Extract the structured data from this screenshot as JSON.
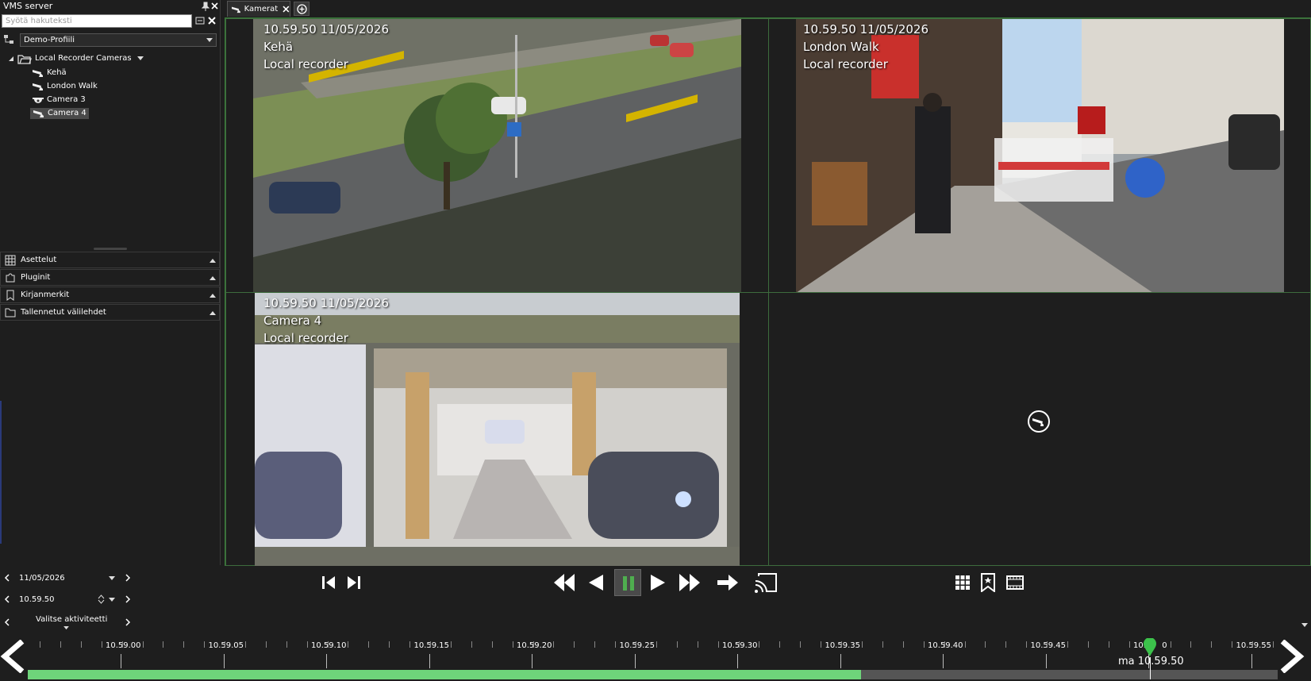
{
  "left_panel": {
    "title": "VMS server",
    "search_placeholder": "Syötä hakuteksti",
    "profile": "Demo-Profiili",
    "tree": {
      "root_label": "Local Recorder Cameras",
      "items": [
        {
          "label": "Kehä",
          "icon": "camera-icon"
        },
        {
          "label": "London Walk",
          "icon": "camera-icon"
        },
        {
          "label": "Camera 3",
          "icon": "dome-camera-icon"
        },
        {
          "label": "Camera 4",
          "icon": "camera-icon",
          "selected": true
        }
      ]
    },
    "sections": [
      {
        "label": "Asettelut",
        "icon": "grid-icon"
      },
      {
        "label": "Pluginit",
        "icon": "puzzle-icon"
      },
      {
        "label": "Kirjanmerkit",
        "icon": "bookmark-icon"
      },
      {
        "label": "Tallennetut välilehdet",
        "icon": "folder-icon"
      }
    ]
  },
  "tabs": {
    "active_label": "Kamerat"
  },
  "cameras": [
    {
      "timestamp": "10.59.50  11/05/2026",
      "name": "Kehä",
      "source": "Local recorder"
    },
    {
      "timestamp": "10.59.50  11/05/2026",
      "name": "London Walk",
      "source": "Local recorder"
    },
    {
      "timestamp": "10.59.50  11/05/2026",
      "name": "Camera 4",
      "source": "Local recorder"
    }
  ],
  "playback": {
    "date": "11/05/2026",
    "time": "10.59.50",
    "activity_label": "Valitse aktiviteetti",
    "colors": {
      "play_active": "#4fae4f",
      "timeline_fill": "#6ed47a"
    }
  },
  "timeline": {
    "ticks": [
      "10.59.00",
      "10.59.05",
      "10.59.10",
      "10.59.15",
      "10.59.20",
      "10.59.25",
      "10.59.30",
      "10.59.35",
      "10.59.40",
      "10.59.45",
      "10.59.50",
      "10.59.55"
    ],
    "cursor_label": "ma 10.59.50"
  }
}
